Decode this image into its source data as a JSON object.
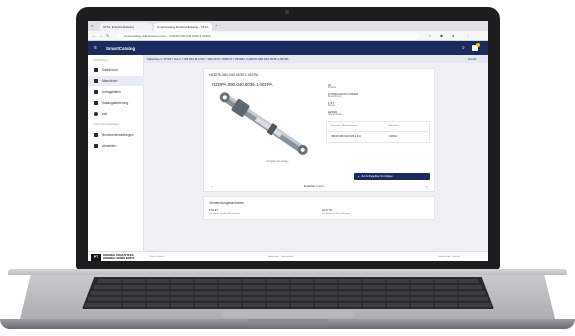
{
  "browser": {
    "tabs": [
      {
        "label": "STILL Ersatzteilkatalog"
      },
      {
        "label": "SmartCatalog Ersatzteilkatalog - STILL"
      }
    ],
    "new_tab": "+",
    "url": "smartcatalog.stillpartsweb.com/…/HZDPA.080.040.0035.1.001PA"
  },
  "app": {
    "title": "SmartCatalog"
  },
  "sidebar": {
    "section_top": "Einstellung",
    "items": [
      {
        "label": "Dashboard"
      },
      {
        "label": "Maschinen"
      },
      {
        "label": "Anfragelisten"
      },
      {
        "label": "Katalogaktivierung"
      },
      {
        "label": "Info"
      }
    ],
    "section_bottom": "Konto-Einstellungen",
    "bottom_items": [
      {
        "label": "Benutzereinstellungen"
      },
      {
        "label": "Abmelden"
      }
    ]
  },
  "breadcrumb": {
    "text": "Maschinen / RT90 / Teil 1 / 105.8A LB A790 / 160.0370 / 805073 / 053384 / HZDPA.080.040.0035.1.001PA",
    "right": "Zurück"
  },
  "part": {
    "header": "HZDPA.080.040.0035.1.001PA",
    "title": "HZDPA.080.040.0035.1.001PA",
    "image_caption": "Verfügbar auf Anfrage",
    "fields": [
      {
        "value": "10",
        "label": "Position"
      },
      {
        "value": "HYDRAULIKZYLINDER",
        "label": "Bezeichnung"
      },
      {
        "value": "1 ST",
        "label": "Menge"
      },
      {
        "value": "HZDPA",
        "label": "Teile-Nummer"
      }
    ],
    "table": {
      "headers": [
        "Ersatzteil / Materialnummer",
        "Alternative"
      ],
      "rows": [
        [
          "HZDPA.080.040.0035.1.001",
          "493894"
        ]
      ]
    },
    "add_button": "Zur Anfrageliste hinzufügen",
    "pager": "Ersatzteil 1 von 2"
  },
  "usage": {
    "title": "Verwendungsnachweis",
    "items": [
      {
        "value": "0.02 ET",
        "label": "Positionen im aktuellen Katalog"
      },
      {
        "value": "02.07 ET",
        "label": "Positionen in allen Katalogen"
      }
    ]
  },
  "footer": {
    "logo_text_1": "ORIGINAL ERSATZTEILE",
    "logo_text_2": "ORIGINAL SPARE PARTS",
    "left": "© Kion & Partner",
    "center": "Impressum · Datenschutz",
    "right": "Datenschutz · Cookies"
  },
  "colors": {
    "appbar": "#1a2b5e",
    "accent": "#1a2b5e",
    "badge": "#f5c400"
  }
}
